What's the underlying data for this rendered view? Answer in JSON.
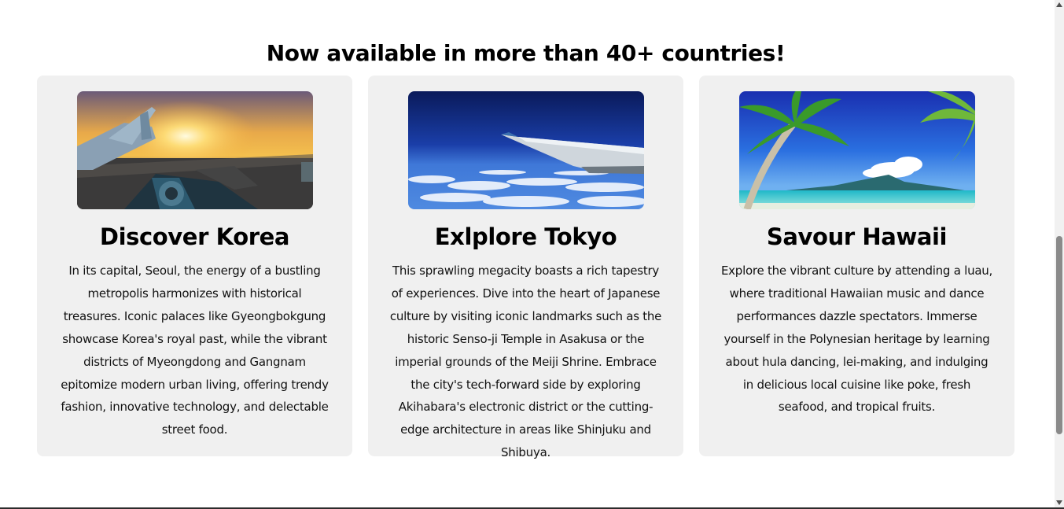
{
  "section": {
    "heading": "Now available in more than 40+ countries!"
  },
  "cards": [
    {
      "image": "airplane-at-sunset-photo",
      "title": "Discover Korea",
      "text": "In its capital, Seoul, the energy of a bustling metropolis harmonizes with historical treasures. Iconic palaces like Gyeongbokgung showcase Korea's royal past, while the vibrant districts of Myeongdong and Gangnam epitomize modern urban living, offering trendy fashion, innovative technology, and delectable street food."
    },
    {
      "image": "airplane-wing-above-clouds-photo",
      "title": "Exlplore Tokyo",
      "text": "This sprawling megacity boasts a rich tapestry of experiences. Dive into the heart of Japanese culture by visiting iconic landmarks such as the historic Senso-ji Temple in Asakusa or the imperial grounds of the Meiji Shrine. Embrace the city's tech-forward side by exploring Akihabara's electronic district or the cutting-edge architecture in areas like Shinjuku and Shibuya."
    },
    {
      "image": "tropical-beach-palm-trees-photo",
      "title": "Savour Hawaii",
      "text": "Explore the vibrant culture by attending a luau, where traditional Hawaiian music and dance performances dazzle spectators. Immerse yourself in the Polynesian heritage by learning about hula dancing, lei-making, and indulging in delicious local cuisine like poke, fresh seafood, and tropical fruits."
    }
  ],
  "colors": {
    "card_background": "#f0f0f0",
    "page_background": "#ffffff",
    "text": "#000000"
  }
}
